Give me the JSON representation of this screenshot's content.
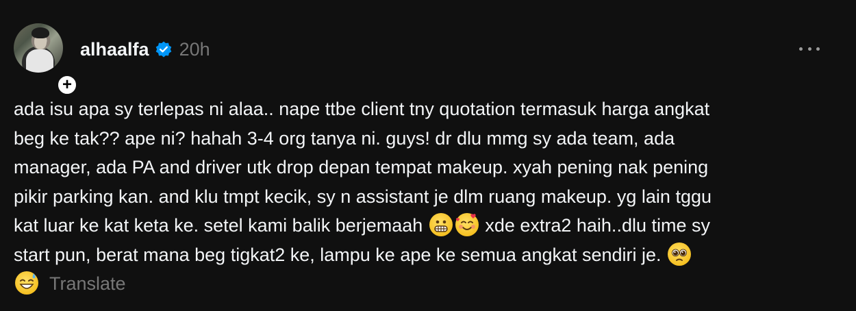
{
  "post": {
    "username": "alhaalfa",
    "time": "20h",
    "text_lines": [
      "ada isu apa sy terlepas ni alaa.. nape ttbe client tny quotation termasuk harga angkat",
      "beg ke tak?? ape ni? hahah 3-4 org tanya ni. guys! dr dlu mmg sy ada team, ada",
      "manager, ada PA and driver utk drop depan tempat makeup. xyah pening nak pening",
      "pikir parking kan. and klu tmpt kecik, sy n assistant je dlm ruang makeup. yg lain tggu"
    ],
    "line5_before": "kat luar ke kat keta ke. setel kami balik berjemaah",
    "line5_after": " xde extra2 haih..dlu time sy",
    "line6": "start pun, berat mana beg tigkat2 ke, lampu ke ape ke semua angkat sendiri je. ",
    "translate_label": "Translate"
  },
  "icons": {
    "avatar": "user-avatar",
    "follow": "plus-icon",
    "verified": "verified-badge-icon",
    "more": "more-horizontal-icon",
    "emojis": [
      "grimacing-face",
      "smiling-face-with-hearts",
      "pleading-face",
      "grinning-face-with-sweat"
    ]
  },
  "colors": {
    "background": "#101010",
    "text": "#f3f5f7",
    "muted": "#777777",
    "verified": "#0095f6"
  }
}
